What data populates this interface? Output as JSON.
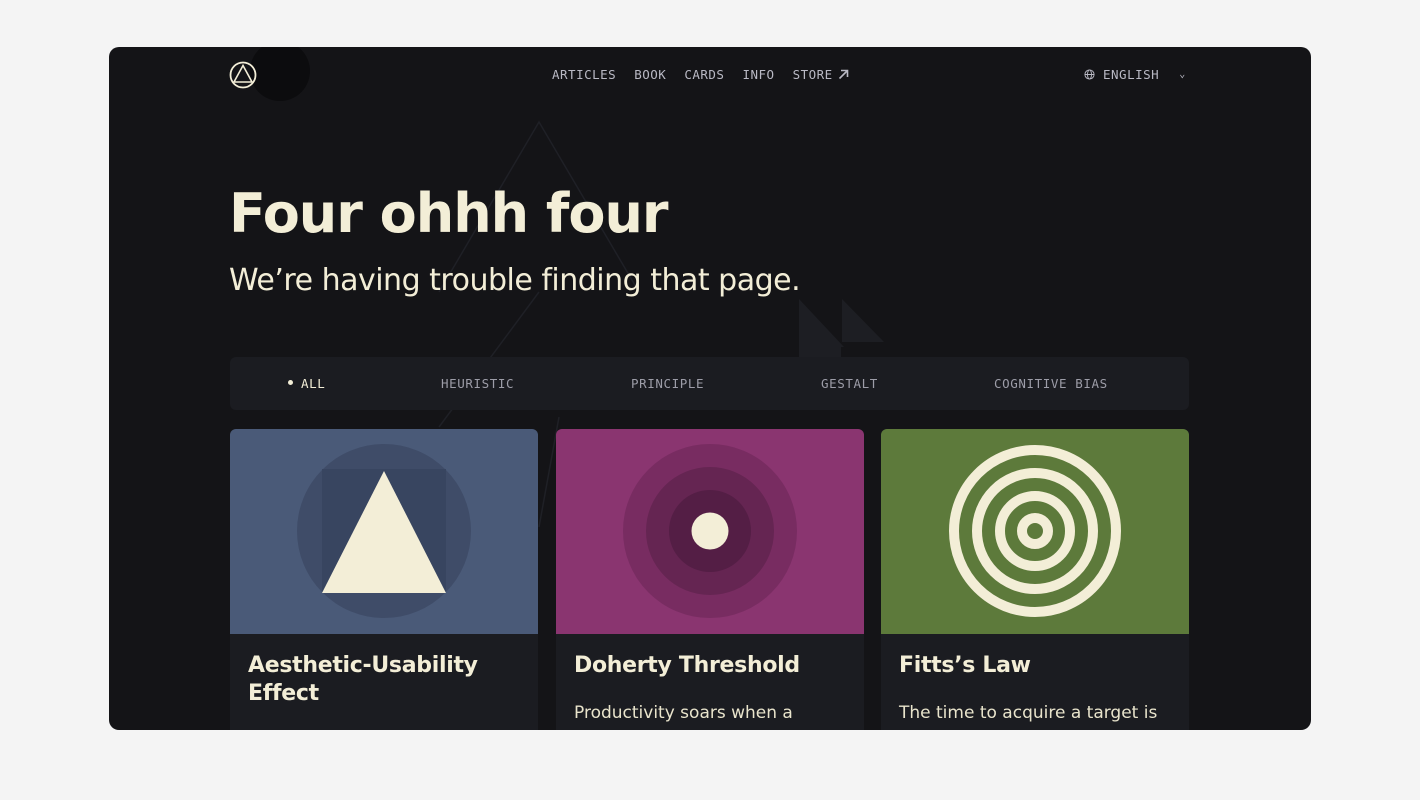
{
  "header": {
    "nav": [
      {
        "label": "ARTICLES"
      },
      {
        "label": "BOOK"
      },
      {
        "label": "CARDS"
      },
      {
        "label": "INFO"
      },
      {
        "label": "STORE"
      }
    ],
    "language": "ENGLISH"
  },
  "hero": {
    "title": "Four ohhh four",
    "subtitle": "We’re having trouble finding that page."
  },
  "filters": [
    {
      "label": "ALL",
      "active": true
    },
    {
      "label": "HEURISTIC",
      "active": false
    },
    {
      "label": "PRINCIPLE",
      "active": false
    },
    {
      "label": "GESTALT",
      "active": false
    },
    {
      "label": "COGNITIVE BIAS",
      "active": false
    }
  ],
  "cards": [
    {
      "title": "Aesthetic-Usability Effect",
      "description": "",
      "color": "#4a5a78",
      "icon": "triangle-icon"
    },
    {
      "title": "Doherty Threshold",
      "description": "Productivity soars when a computer and its users",
      "color": "#8a3570",
      "icon": "concentric-circles-icon"
    },
    {
      "title": "Fitts’s Law",
      "description": "The time to acquire a target is a function of the distance",
      "color": "#5d7a3b",
      "icon": "target-rings-icon"
    }
  ],
  "colors": {
    "page_background": "#f4f4f4",
    "window_background": "#141417",
    "text_cream": "#f3eed7",
    "nav_text": "#b9b9c4"
  }
}
